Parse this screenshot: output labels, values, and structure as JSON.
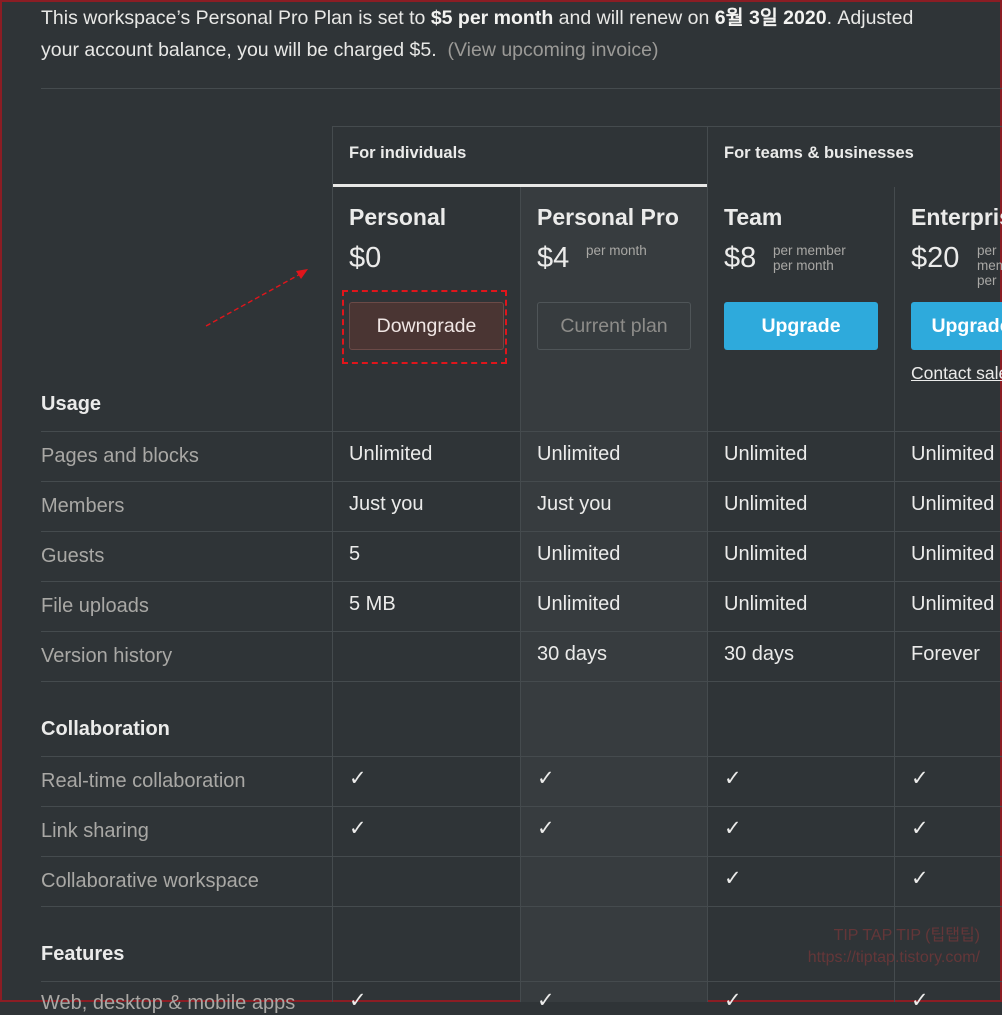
{
  "intro": {
    "line1_a": "This workspace’s Personal Pro Plan is set to ",
    "line1_b": "$5 per month",
    "line1_c": " and will renew on ",
    "line1_d": "6월 3일 2020",
    "line1_e": ". Adjusted",
    "line2_a": "your account balance, you will be charged $5.",
    "line2_link": "(View upcoming invoice)"
  },
  "groups": {
    "individuals": "For individuals",
    "teams": "For teams & businesses"
  },
  "plans": [
    {
      "name": "Personal",
      "price": "$0",
      "unit1": "",
      "unit2": "",
      "unit3": "",
      "button": "Downgrade"
    },
    {
      "name": "Personal Pro",
      "price": "$4",
      "unit1": "per month",
      "unit2": "",
      "unit3": "",
      "button": "Current plan"
    },
    {
      "name": "Team",
      "price": "$8",
      "unit1": "per member",
      "unit2": "per month",
      "unit3": "",
      "button": "Upgrade"
    },
    {
      "name": "Enterprise",
      "price": "$20",
      "unit1": "per",
      "unit2": "mem",
      "unit3": "per",
      "button": "Upgrade",
      "contact": "Contact sales"
    }
  ],
  "sections": {
    "usage": "Usage",
    "collaboration": "Collaboration",
    "features": "Features"
  },
  "usage_rows": [
    {
      "label": "Pages and blocks",
      "values": [
        "Unlimited",
        "Unlimited",
        "Unlimited",
        "Unlimited"
      ]
    },
    {
      "label": "Members",
      "values": [
        "Just you",
        "Just you",
        "Unlimited",
        "Unlimited"
      ]
    },
    {
      "label": "Guests",
      "values": [
        "5",
        "Unlimited",
        "Unlimited",
        "Unlimited"
      ]
    },
    {
      "label": "File uploads",
      "values": [
        "5 MB",
        "Unlimited",
        "Unlimited",
        "Unlimited"
      ]
    },
    {
      "label": "Version history",
      "values": [
        "",
        "30 days",
        "30 days",
        "Forever"
      ]
    }
  ],
  "collab_rows": [
    {
      "label": "Real-time collaboration",
      "values": [
        "✓",
        "✓",
        "✓",
        "✓"
      ]
    },
    {
      "label": "Link sharing",
      "values": [
        "✓",
        "✓",
        "✓",
        "✓"
      ]
    },
    {
      "label": "Collaborative workspace",
      "values": [
        "",
        "",
        "✓",
        "✓"
      ]
    }
  ],
  "features_rows": [
    {
      "label": "Web, desktop & mobile apps",
      "values": [
        "✓",
        "✓",
        "✓",
        "✓"
      ]
    }
  ],
  "watermark": {
    "line1": "TIP TAP TIP (팁탭팁)",
    "line2": "https://tiptap.tistory.com/"
  },
  "colors": {
    "background": "#2f3437",
    "accent_blue": "#2eaadc",
    "highlight_red": "#e0151b"
  }
}
